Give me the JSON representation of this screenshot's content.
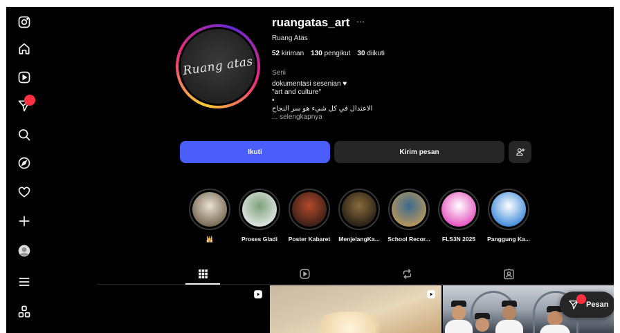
{
  "sidebar": {
    "items": [
      {
        "icon": "instagram-logo-icon"
      },
      {
        "icon": "home-icon"
      },
      {
        "icon": "reels-icon"
      },
      {
        "icon": "messages-icon",
        "has_badge": true
      },
      {
        "icon": "search-icon"
      },
      {
        "icon": "explore-compass-icon"
      },
      {
        "icon": "notifications-heart-icon"
      },
      {
        "icon": "create-plus-icon"
      },
      {
        "icon": "profile-avatar-icon"
      },
      {
        "icon": "menu-icon"
      },
      {
        "icon": "also-from-meta-icon"
      }
    ]
  },
  "profile": {
    "username": "ruangatas_art",
    "more": "···",
    "full_name": "Ruang Atas",
    "avatar_text": "Ruang atas",
    "stats": {
      "posts_count": "52",
      "posts_label": "kiriman",
      "followers_count": "130",
      "followers_label": "pengikut",
      "following_count": "30",
      "following_label": "diikuti"
    },
    "category": "Seni",
    "bio": {
      "line1": "dokumentasi sesenian",
      "heart": "♥",
      "line2": "\"art and culture\"",
      "line3": "•",
      "line4": "الاعتدال في كل شيء هو سر النجاح",
      "more": "... selengkapnya"
    }
  },
  "actions": {
    "follow_label": "Ikuti",
    "message_label": "Kirim pesan",
    "suggest_icon": "add-person-icon"
  },
  "highlights": [
    {
      "label": "🕌",
      "colors": [
        "#e9e1d2",
        "#6b5b45"
      ]
    },
    {
      "label": "Proses Gladi",
      "colors": [
        "#7fa27a",
        "#e9ecef"
      ]
    },
    {
      "label": "Poster Kabaret",
      "colors": [
        "#b44a2b",
        "#2a1a14"
      ]
    },
    {
      "label": "MenjelangKa...",
      "colors": [
        "#8a6b3c",
        "#1b1710"
      ]
    },
    {
      "label": "School Recor...",
      "colors": [
        "#3a6b8f",
        "#c49a56"
      ]
    },
    {
      "label": "FLS3N 2025",
      "colors": [
        "#ffffff",
        "#e23fb8"
      ]
    },
    {
      "label": "Panggung Ka...",
      "colors": [
        "#ffffff",
        "#2b7fd6"
      ]
    }
  ],
  "tabs": [
    {
      "name": "posts",
      "icon": "grid-icon",
      "active": true
    },
    {
      "name": "reels",
      "icon": "reels-icon",
      "active": false
    },
    {
      "name": "reposts",
      "icon": "repost-icon",
      "active": false
    },
    {
      "name": "tagged",
      "icon": "tagged-icon",
      "active": false
    }
  ],
  "messages_pill": {
    "label": "Pesan"
  },
  "colors": {
    "background": "#000000",
    "primary_button": "#4a5df9",
    "secondary_button": "#262626",
    "notification": "#ff3040"
  }
}
